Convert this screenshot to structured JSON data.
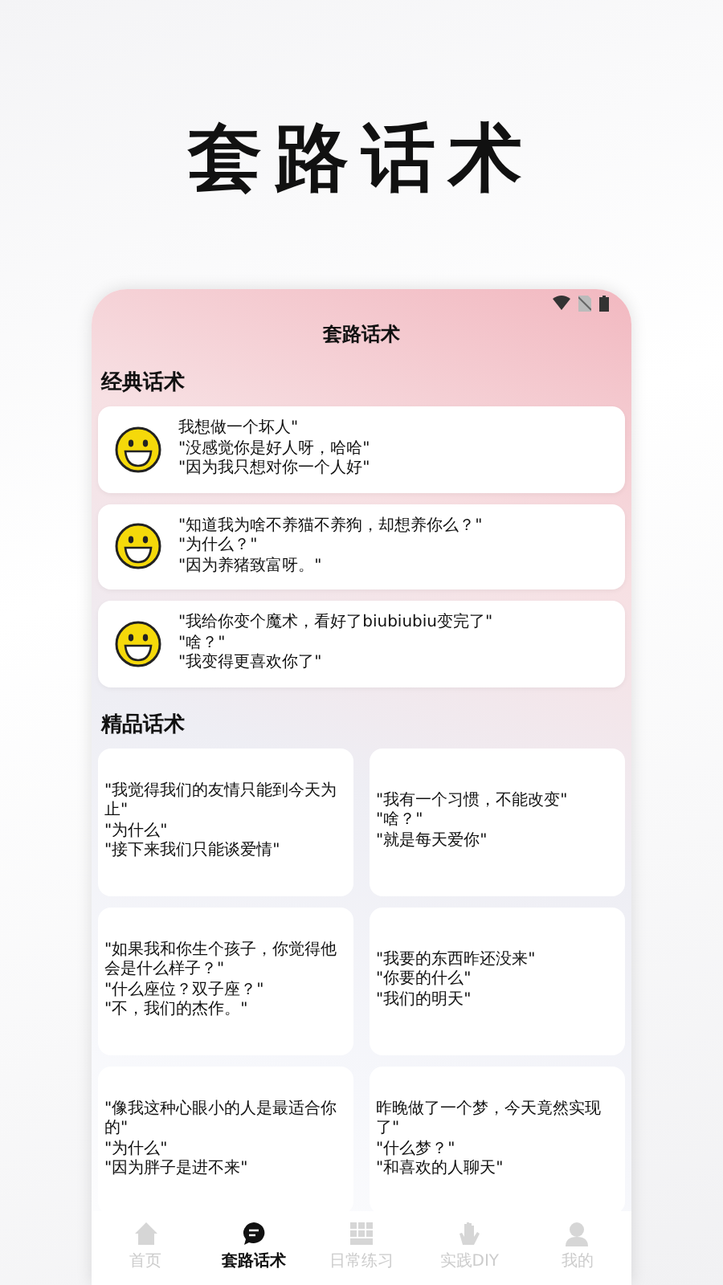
{
  "promo_title": "套路话术",
  "app": {
    "title": "套路话术"
  },
  "sections": [
    {
      "title": "经典话术",
      "kind": "list",
      "items": [
        {
          "lines": [
            "我想做一个坏人\"",
            "\"没感觉你是好人呀，哈哈\"",
            "\"因为我只想对你一个人好\""
          ]
        },
        {
          "lines": [
            "\"知道我为啥不养猫不养狗，却想养你么？\"",
            "\"为什么？\"",
            "\"因为养猪致富呀。\""
          ]
        },
        {
          "lines": [
            "\"我给你变个魔术，看好了biubiubiu变完了\"",
            "\"啥？\"",
            "\"我变得更喜欢你了\""
          ]
        }
      ]
    },
    {
      "title": "精品话术",
      "kind": "grid",
      "items": [
        {
          "lines": [
            "\"我觉得我们的友情只能到今天为止\"",
            "\"为什么\"",
            "\"接下来我们只能谈爱情\""
          ]
        },
        {
          "lines": [
            "\"我有一个习惯，不能改变\"",
            "\"啥？\"",
            "\"就是每天爱你\""
          ]
        },
        {
          "lines": [
            "\"如果我和你生个孩子，你觉得他会是什么样子？\"",
            "\"什么座位？双子座？\"",
            "\"不，我们的杰作。\""
          ]
        },
        {
          "lines": [
            "\"我要的东西昨还没来\"",
            "\"你要的什么\"",
            "\"我们的明天\""
          ]
        },
        {
          "lines": [
            "\"像我这种心眼小的人是最适合你的\"",
            "\"为什么\"",
            "\"因为胖子是进不来\""
          ]
        },
        {
          "lines": [
            "昨晚做了一个梦，今天竟然实现了\"",
            "\"什么梦？\"",
            "\"和喜欢的人聊天\""
          ]
        }
      ]
    }
  ],
  "tab_bar": [
    {
      "label": "首页",
      "selected": false
    },
    {
      "label": "套路话术",
      "selected": true
    },
    {
      "label": "日常练习",
      "selected": false
    },
    {
      "label": "实践DIY",
      "selected": false
    },
    {
      "label": "我的",
      "selected": false
    }
  ]
}
